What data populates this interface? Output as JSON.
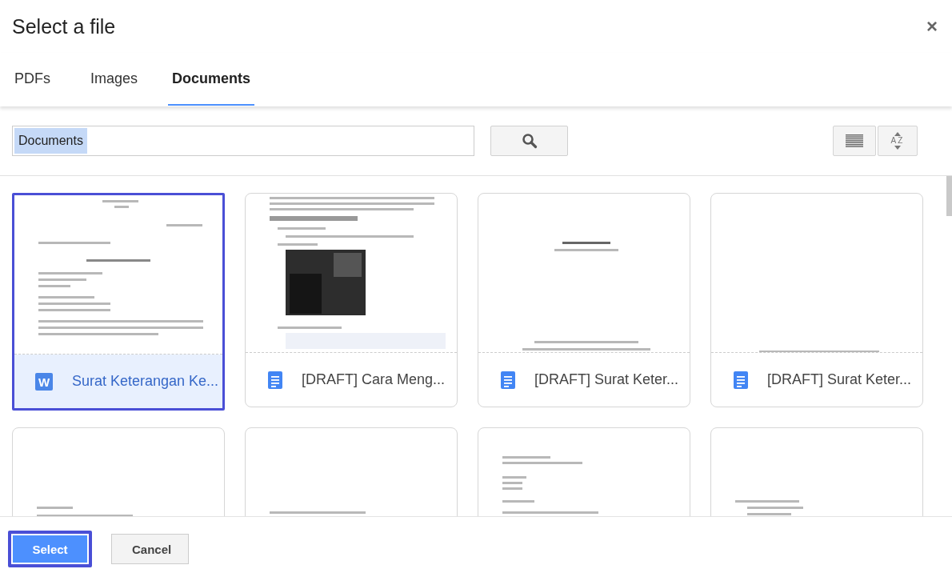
{
  "dialog": {
    "title": "Select a file",
    "close": "×"
  },
  "tabs": [
    {
      "label": "PDFs",
      "selected": false
    },
    {
      "label": "Images",
      "selected": false
    },
    {
      "label": "Documents",
      "selected": true
    }
  ],
  "search": {
    "value": "Documents",
    "value_selected": true
  },
  "sort": {
    "label": "AZ"
  },
  "files": [
    {
      "name": "Surat Keterangan Ke...",
      "kind": "word",
      "badge": "W",
      "selected": true
    },
    {
      "name": "[DRAFT] Cara Meng...",
      "kind": "doc",
      "selected": false
    },
    {
      "name": "[DRAFT] Surat Keter...",
      "kind": "doc",
      "selected": false
    },
    {
      "name": "[DRAFT] Surat Keter...",
      "kind": "doc",
      "selected": false
    },
    {
      "selected": false
    },
    {
      "selected": false
    },
    {
      "selected": false
    },
    {
      "selected": false
    }
  ],
  "buttons": [
    {
      "label": "Select",
      "kind": "primary",
      "focused": true
    },
    {
      "label": "Cancel",
      "kind": "secondary",
      "focused": false
    }
  ]
}
